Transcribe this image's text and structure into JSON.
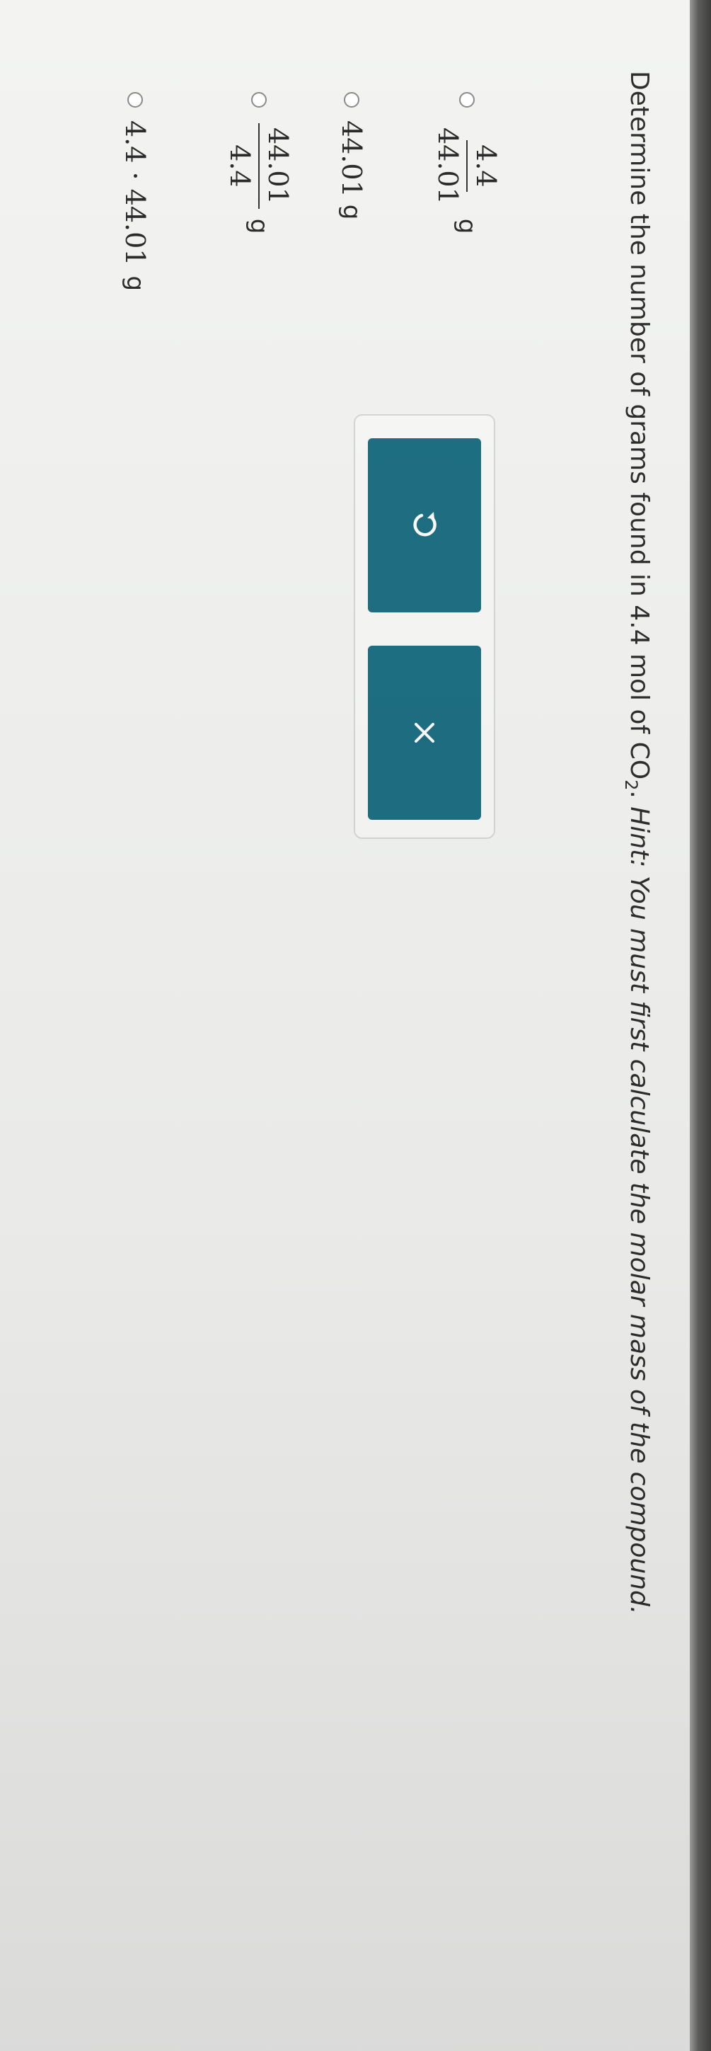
{
  "question": {
    "prefix": "Determine the number of grams found in 4.4 mol of CO",
    "subscript": "2",
    "period": ". ",
    "hint": "Hint: You must first calculate the molar mass of the compound."
  },
  "options": [
    {
      "numerator": "4.4",
      "denominator": "44.01",
      "unit": "g"
    },
    {
      "text": "44.01",
      "unit": "g"
    },
    {
      "numerator": "44.01",
      "denominator": "4.4",
      "unit": "g"
    },
    {
      "text": "4.4 · 44.01",
      "unit": "g"
    }
  ],
  "icons": {
    "undo": "undo-icon",
    "clear": "close-icon"
  },
  "colors": {
    "button": "#1e6f83",
    "button_icon": "#ffffff"
  }
}
